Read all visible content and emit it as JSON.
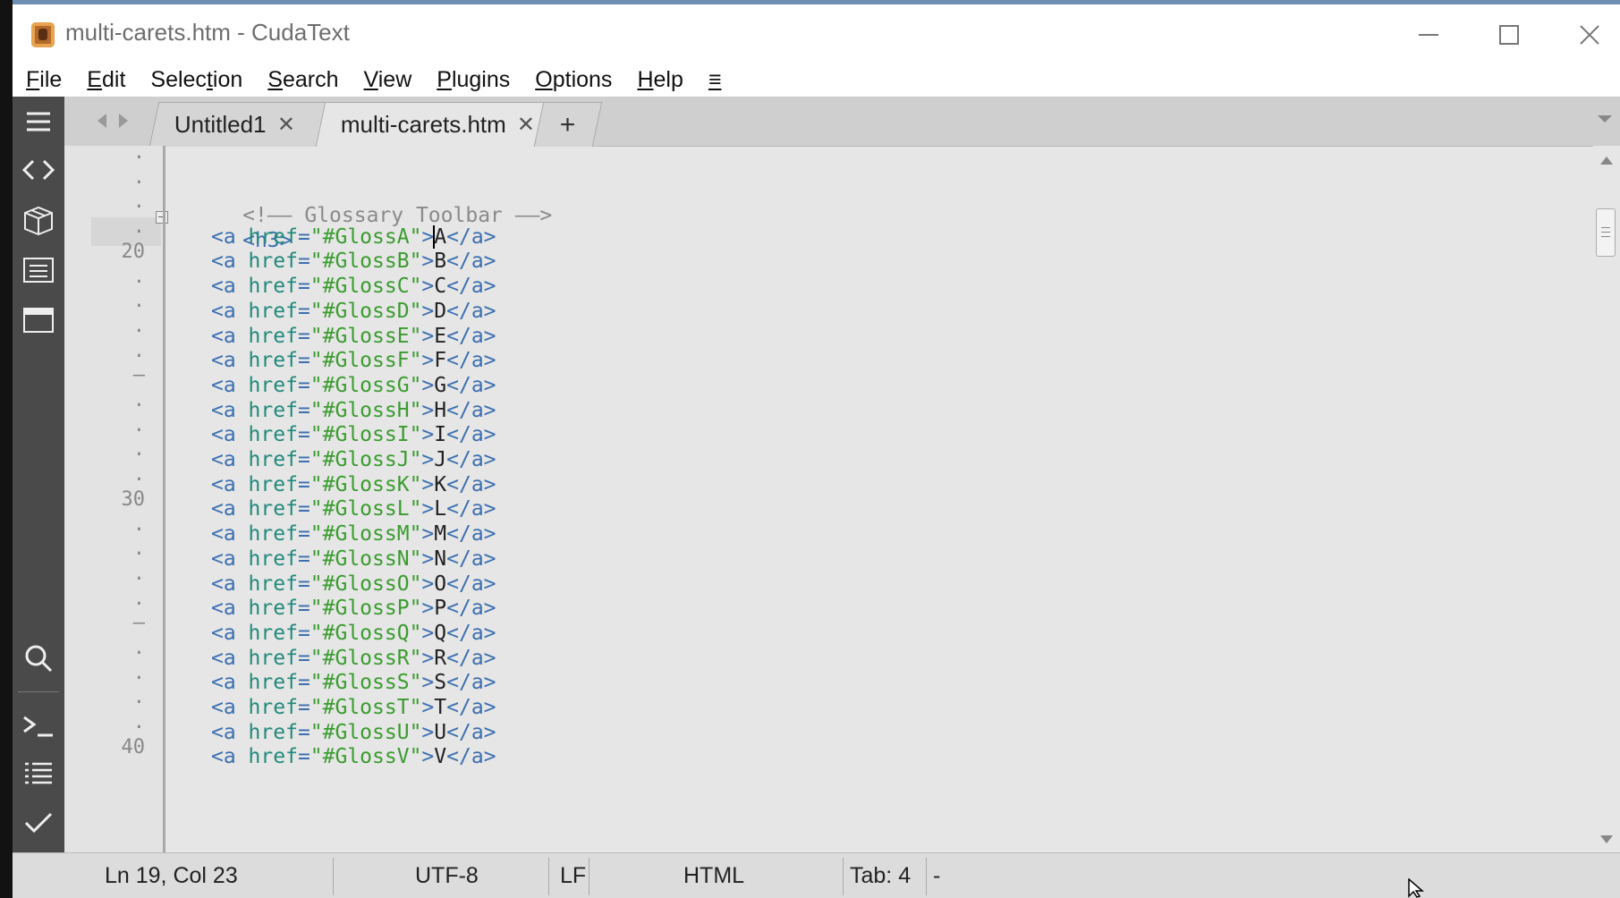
{
  "window": {
    "title": "multi-carets.htm - CudaText"
  },
  "menu": [
    {
      "pre": "",
      "u": "F",
      "post": "ile"
    },
    {
      "pre": "",
      "u": "E",
      "post": "dit"
    },
    {
      "pre": "Selec",
      "u": "t",
      "post": "ion"
    },
    {
      "pre": "",
      "u": "S",
      "post": "earch"
    },
    {
      "pre": "",
      "u": "V",
      "post": "iew"
    },
    {
      "pre": "",
      "u": "P",
      "post": "lugins"
    },
    {
      "pre": "",
      "u": "O",
      "post": "ptions"
    },
    {
      "pre": "",
      "u": "H",
      "post": "elp"
    },
    {
      "pre": "",
      "u": "≡",
      "post": ""
    }
  ],
  "tabs": [
    {
      "label": "Untitled1",
      "close": "✕"
    },
    {
      "label": "multi-carets.htm",
      "close": "✕"
    }
  ],
  "new_tab_label": "+",
  "gutter": [
    ".",
    ".",
    ".",
    ".",
    "20",
    ".",
    ".",
    ".",
    ".",
    "–",
    ".",
    ".",
    ".",
    ".",
    "30",
    ".",
    ".",
    ".",
    ".",
    "–",
    ".",
    ".",
    ".",
    ".",
    "40"
  ],
  "editor": {
    "comment": "<!—— Glossary Toolbar ——>",
    "h3_open": "<h3>",
    "links": [
      {
        "href": "\"#GlossA\"",
        "text": "A"
      },
      {
        "href": "\"#GlossB\"",
        "text": "B"
      },
      {
        "href": "\"#GlossC\"",
        "text": "C"
      },
      {
        "href": "\"#GlossD\"",
        "text": "D"
      },
      {
        "href": "\"#GlossE\"",
        "text": "E"
      },
      {
        "href": "\"#GlossF\"",
        "text": "F"
      },
      {
        "href": "\"#GlossG\"",
        "text": "G"
      },
      {
        "href": "\"#GlossH\"",
        "text": "H"
      },
      {
        "href": "\"#GlossI\"",
        "text": "I"
      },
      {
        "href": "\"#GlossJ\"",
        "text": "J"
      },
      {
        "href": "\"#GlossK\"",
        "text": "K"
      },
      {
        "href": "\"#GlossL\"",
        "text": "L"
      },
      {
        "href": "\"#GlossM\"",
        "text": "M"
      },
      {
        "href": "\"#GlossN\"",
        "text": "N"
      },
      {
        "href": "\"#GlossO\"",
        "text": "O"
      },
      {
        "href": "\"#GlossP\"",
        "text": "P"
      },
      {
        "href": "\"#GlossQ\"",
        "text": "Q"
      },
      {
        "href": "\"#GlossR\"",
        "text": "R"
      },
      {
        "href": "\"#GlossS\"",
        "text": "S"
      },
      {
        "href": "\"#GlossT\"",
        "text": "T"
      },
      {
        "href": "\"#GlossU\"",
        "text": "U"
      },
      {
        "href": "\"#GlossV\"",
        "text": "V"
      }
    ],
    "tag_open": "<a ",
    "attr_name": "href",
    "eq": "=",
    "tag_gt": ">",
    "tag_close": "</a>"
  },
  "status": {
    "position": "Ln 19, Col 23",
    "encoding": "UTF-8",
    "line_ending": "LF",
    "lexer": "HTML",
    "tab_size": "Tab: 4",
    "extra": "-"
  },
  "sidebar_icons": [
    "menu-icon",
    "code-icon",
    "package-icon",
    "list-panel-icon",
    "window-icon",
    "search-icon",
    "console-icon",
    "list-icon",
    "check-icon"
  ]
}
